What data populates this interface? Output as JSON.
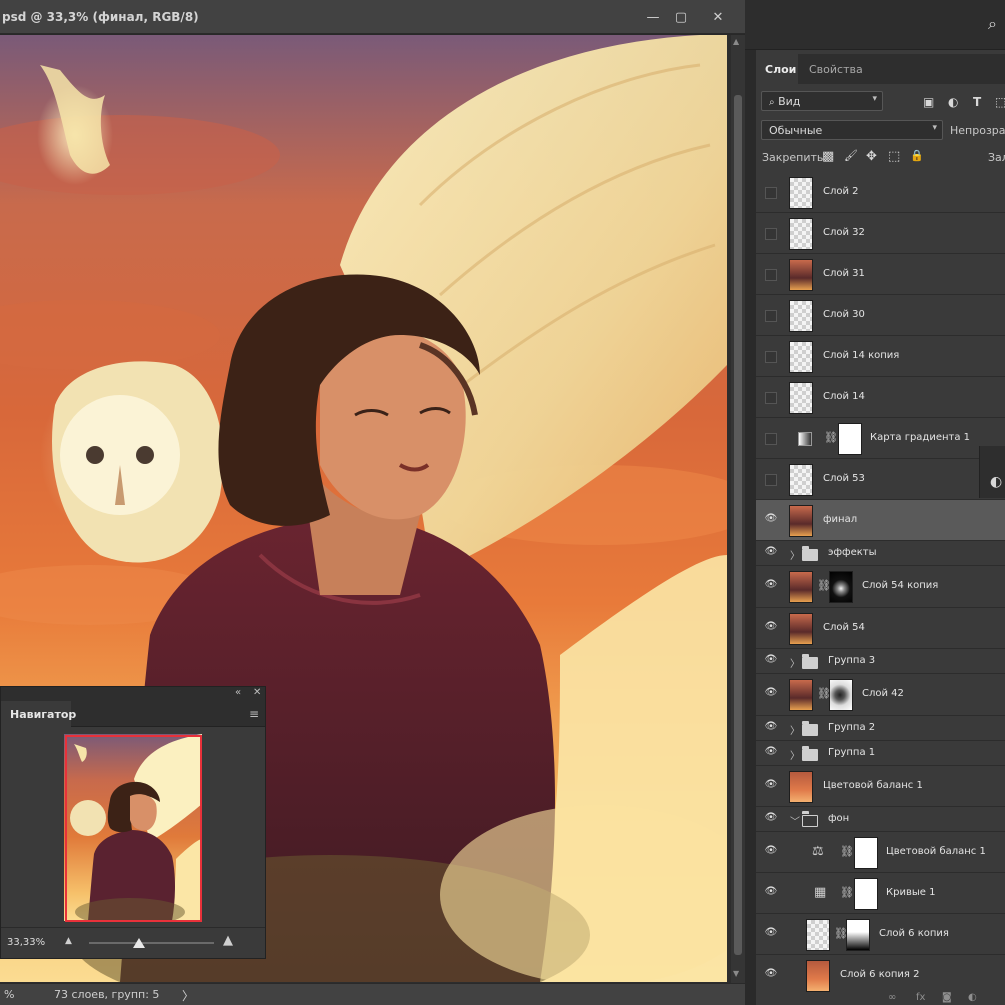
{
  "document": {
    "title": "psd @ 33,3% (финал, RGB/8)",
    "window_controls": {
      "minimize": "—",
      "restore": "▢",
      "close": "✕"
    }
  },
  "status_bar": {
    "zoom": "%",
    "info": "73 слоев, групп: 5",
    "arrow": "〉"
  },
  "navigator": {
    "tab": "Навигатор",
    "zoom_value": "33,33%",
    "zoom_fraction": 0.4,
    "collapse_glyph": "«",
    "close_glyph": "✕",
    "menu_glyph": "≡",
    "zoom_out_glyph": "▲",
    "zoom_in_glyph": "▲"
  },
  "app": {
    "search_glyph": "⌕"
  },
  "panel": {
    "tabs": {
      "layers": "Слои",
      "properties": "Свойства"
    },
    "filter": {
      "label": "Вид",
      "chevron": "▾"
    },
    "blend_mode": {
      "value": "Обычные",
      "chevron": "▾"
    },
    "opacity_label": "Непрозрачн",
    "lock_label": "Закрепить:",
    "fill_label": "Зал",
    "side_widget_glyph": "◐"
  },
  "layers": [
    {
      "name": "Слой 2",
      "visible": false,
      "thumb": "transparent"
    },
    {
      "name": "Слой 32",
      "visible": false,
      "thumb": "transparent"
    },
    {
      "name": "Слой 31",
      "visible": false,
      "thumb": "art"
    },
    {
      "name": "Слой 30",
      "visible": false,
      "thumb": "transparent"
    },
    {
      "name": "Слой 14 копия",
      "visible": false,
      "thumb": "transparent"
    },
    {
      "name": "Слой 14",
      "visible": false,
      "thumb": "transparent"
    },
    {
      "name": "Карта градиента 1",
      "visible": false,
      "thumb": "adjustment"
    },
    {
      "name": "Слой 53",
      "visible": false,
      "thumb": "transparent"
    },
    {
      "name": "финал",
      "visible": true,
      "thumb": "art",
      "selected": true
    },
    {
      "name": "эффекты",
      "visible": true,
      "thumb": "group"
    },
    {
      "name": "Слой 54 копия",
      "visible": true,
      "thumb": "art_mask"
    },
    {
      "name": "Слой 54",
      "visible": true,
      "thumb": "art"
    },
    {
      "name": "Группа 3",
      "visible": true,
      "thumb": "group"
    },
    {
      "name": "Слой 42",
      "visible": true,
      "thumb": "art_mask"
    },
    {
      "name": "Группа 2",
      "visible": true,
      "thumb": "group"
    },
    {
      "name": "Группа 1",
      "visible": true,
      "thumb": "group"
    },
    {
      "name": "Цветовой баланс 1",
      "visible": true,
      "thumb": "art"
    },
    {
      "name": "фон",
      "visible": true,
      "thumb": "group_open"
    },
    {
      "name": "Цветовой баланс 1",
      "visible": true,
      "thumb": "adjustment"
    },
    {
      "name": "Кривые 1",
      "visible": true,
      "thumb": "adjustment"
    },
    {
      "name": "Слой 6 копия",
      "visible": true,
      "thumb": "transparent_mask"
    },
    {
      "name": "Слой 6 копия 2",
      "visible": true,
      "thumb": "art"
    }
  ],
  "glyphs": {
    "eye": "👁",
    "chain": "⛓",
    "expander": "〉",
    "expander_open": "﹀",
    "balance": "⚖",
    "curves": "▦",
    "lock_pixels": "▩",
    "lock_brush": "🖌",
    "lock_move": "✥",
    "lock_artboard": "⬚",
    "lock_all": "🔒",
    "f_image": "▣",
    "f_adjust": "◐",
    "f_type": "T",
    "f_shape": "⬚"
  }
}
